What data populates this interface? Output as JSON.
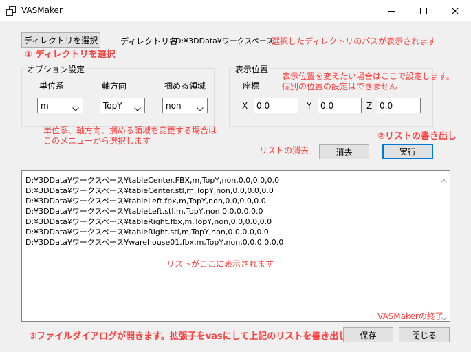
{
  "window": {
    "title": "VASMaker"
  },
  "directory": {
    "select_button": "ディレクトリを選択",
    "name_label": "ディレクトリ名",
    "path_value": "D:¥3DData¥ワークスペース",
    "path_note": "選択したディレクトリのパスが表示されます",
    "step1_note": "① ディレクトリを選択"
  },
  "options": {
    "group_title": "オプション設定",
    "unit_label": "単位系",
    "axis_label": "軸方向",
    "snap_label": "掴める領域",
    "unit_value": "m",
    "axis_value": "TopY",
    "snap_value": "non",
    "note_line1": "単位系、軸方向、掴める領域を変更する場合は",
    "note_line2": "このメニューから選択します"
  },
  "position": {
    "group_title": "表示位置",
    "coord_label": "座標",
    "x_label": "X",
    "y_label": "Y",
    "z_label": "Z",
    "x_value": "0.0",
    "y_value": "0.0",
    "z_value": "0.0",
    "note_line1": "表示位置を変えたい場合はここで設定します。",
    "note_line2": "個別の位置の設定はできません"
  },
  "actions": {
    "clear_note": "リストの消去",
    "clear_button": "消去",
    "run_button": "実行",
    "step2_note": "②リストの書き出し",
    "save_button": "保存",
    "close_button": "閉じる",
    "step3_note": "③ファイルダイアログが開きます。拡張子をvasにして上記のリストを書き出します",
    "exit_note": "VASMakerの終了"
  },
  "list": {
    "items": [
      "D:¥3DData¥ワークスペース¥tableCenter.FBX,m,TopY,non,0.0,0.0,0.0",
      "D:¥3DData¥ワークスペース¥tableCenter.stl,m,TopY,non,0.0,0.0,0.0",
      "D:¥3DData¥ワークスペース¥tableLeft.fbx,m,TopY,non,0.0,0.0,0.0",
      "D:¥3DData¥ワークスペース¥tableLeft.stl,m,TopY,non,0.0,0.0,0.0",
      "D:¥3DData¥ワークスペース¥tableRight.fbx,m,TopY,non,0.0,0.0,0.0",
      "D:¥3DData¥ワークスペース¥tableRight.stl,m,TopY,non,0.0,0.0,0.0",
      "D:¥3DData¥ワークスペース¥warehouse01.fbx,m,TopY,non,0.0,0.0,0.0"
    ],
    "center_note": "リストがここに表示されます"
  },
  "icons": {
    "app": "window-app-icon",
    "minimize": "minimize-icon",
    "maximize": "maximize-icon",
    "close": "close-icon",
    "dropdown": "chevron-down-icon"
  },
  "colors": {
    "annotation": "#ff3b3b",
    "focus_border": "#0078d7",
    "window_bg": "#f0f0f0"
  }
}
